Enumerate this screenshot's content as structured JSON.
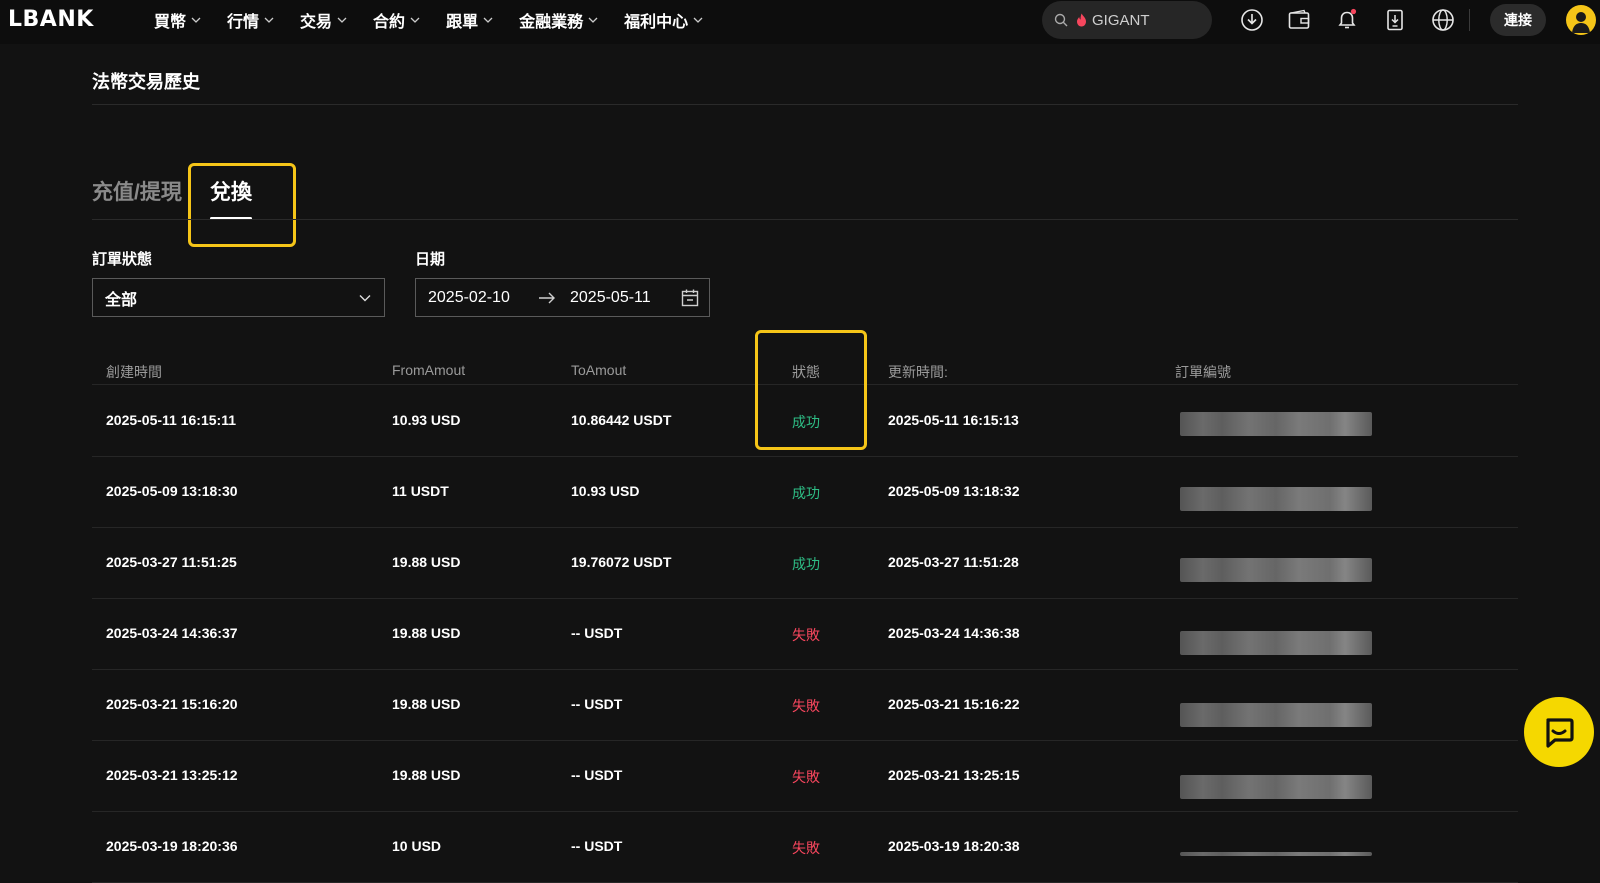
{
  "brand": {
    "logo_text": "LBANK",
    "accent": "#f5c518",
    "success": "#2ebd85",
    "fail": "#f6465d"
  },
  "nav": {
    "items": [
      {
        "label": "買幣"
      },
      {
        "label": "行情"
      },
      {
        "label": "交易"
      },
      {
        "label": "合約"
      },
      {
        "label": "跟單"
      },
      {
        "label": "金融業務"
      },
      {
        "label": "福利中心"
      }
    ],
    "search_placeholder": "GIGANT",
    "connect_label": "連接",
    "icons": [
      "download-icon",
      "wallet-icon",
      "bell-icon",
      "phone-download-icon",
      "globe-icon"
    ]
  },
  "page": {
    "title": "法幣交易歷史"
  },
  "tabs": [
    {
      "label": "充值/提現",
      "active": false
    },
    {
      "label": "兌換",
      "active": true
    }
  ],
  "filters": {
    "status_label": "訂單狀態",
    "status_value": "全部",
    "date_label": "日期",
    "date_start": "2025-02-10",
    "date_end": "2025-05-11"
  },
  "table": {
    "headers": [
      "創建時間",
      "FromAmout",
      "ToAmout",
      "狀態",
      "更新時間:",
      "訂單編號"
    ],
    "rows": [
      {
        "created": "2025-05-11 16:15:11",
        "from": "10.93 USD",
        "to": "10.86442 USDT",
        "status": "成功",
        "updated": "2025-05-11 16:15:13"
      },
      {
        "created": "2025-05-09 13:18:30",
        "from": "11 USDT",
        "to": "10.93 USD",
        "status": "成功",
        "updated": "2025-05-09 13:18:32"
      },
      {
        "created": "2025-03-27 11:51:25",
        "from": "19.88 USD",
        "to": "19.76072 USDT",
        "status": "成功",
        "updated": "2025-03-27 11:51:28"
      },
      {
        "created": "2025-03-24 14:36:37",
        "from": "19.88 USD",
        "to": "-- USDT",
        "status": "失敗",
        "updated": "2025-03-24 14:36:38"
      },
      {
        "created": "2025-03-21 15:16:20",
        "from": "19.88 USD",
        "to": "-- USDT",
        "status": "失敗",
        "updated": "2025-03-21 15:16:22"
      },
      {
        "created": "2025-03-21 13:25:12",
        "from": "19.88 USD",
        "to": "-- USDT",
        "status": "失敗",
        "updated": "2025-03-21 13:25:15"
      },
      {
        "created": "2025-03-19 18:20:36",
        "from": "10 USD",
        "to": "-- USDT",
        "status": "失敗",
        "updated": "2025-03-19 18:20:38"
      }
    ]
  }
}
